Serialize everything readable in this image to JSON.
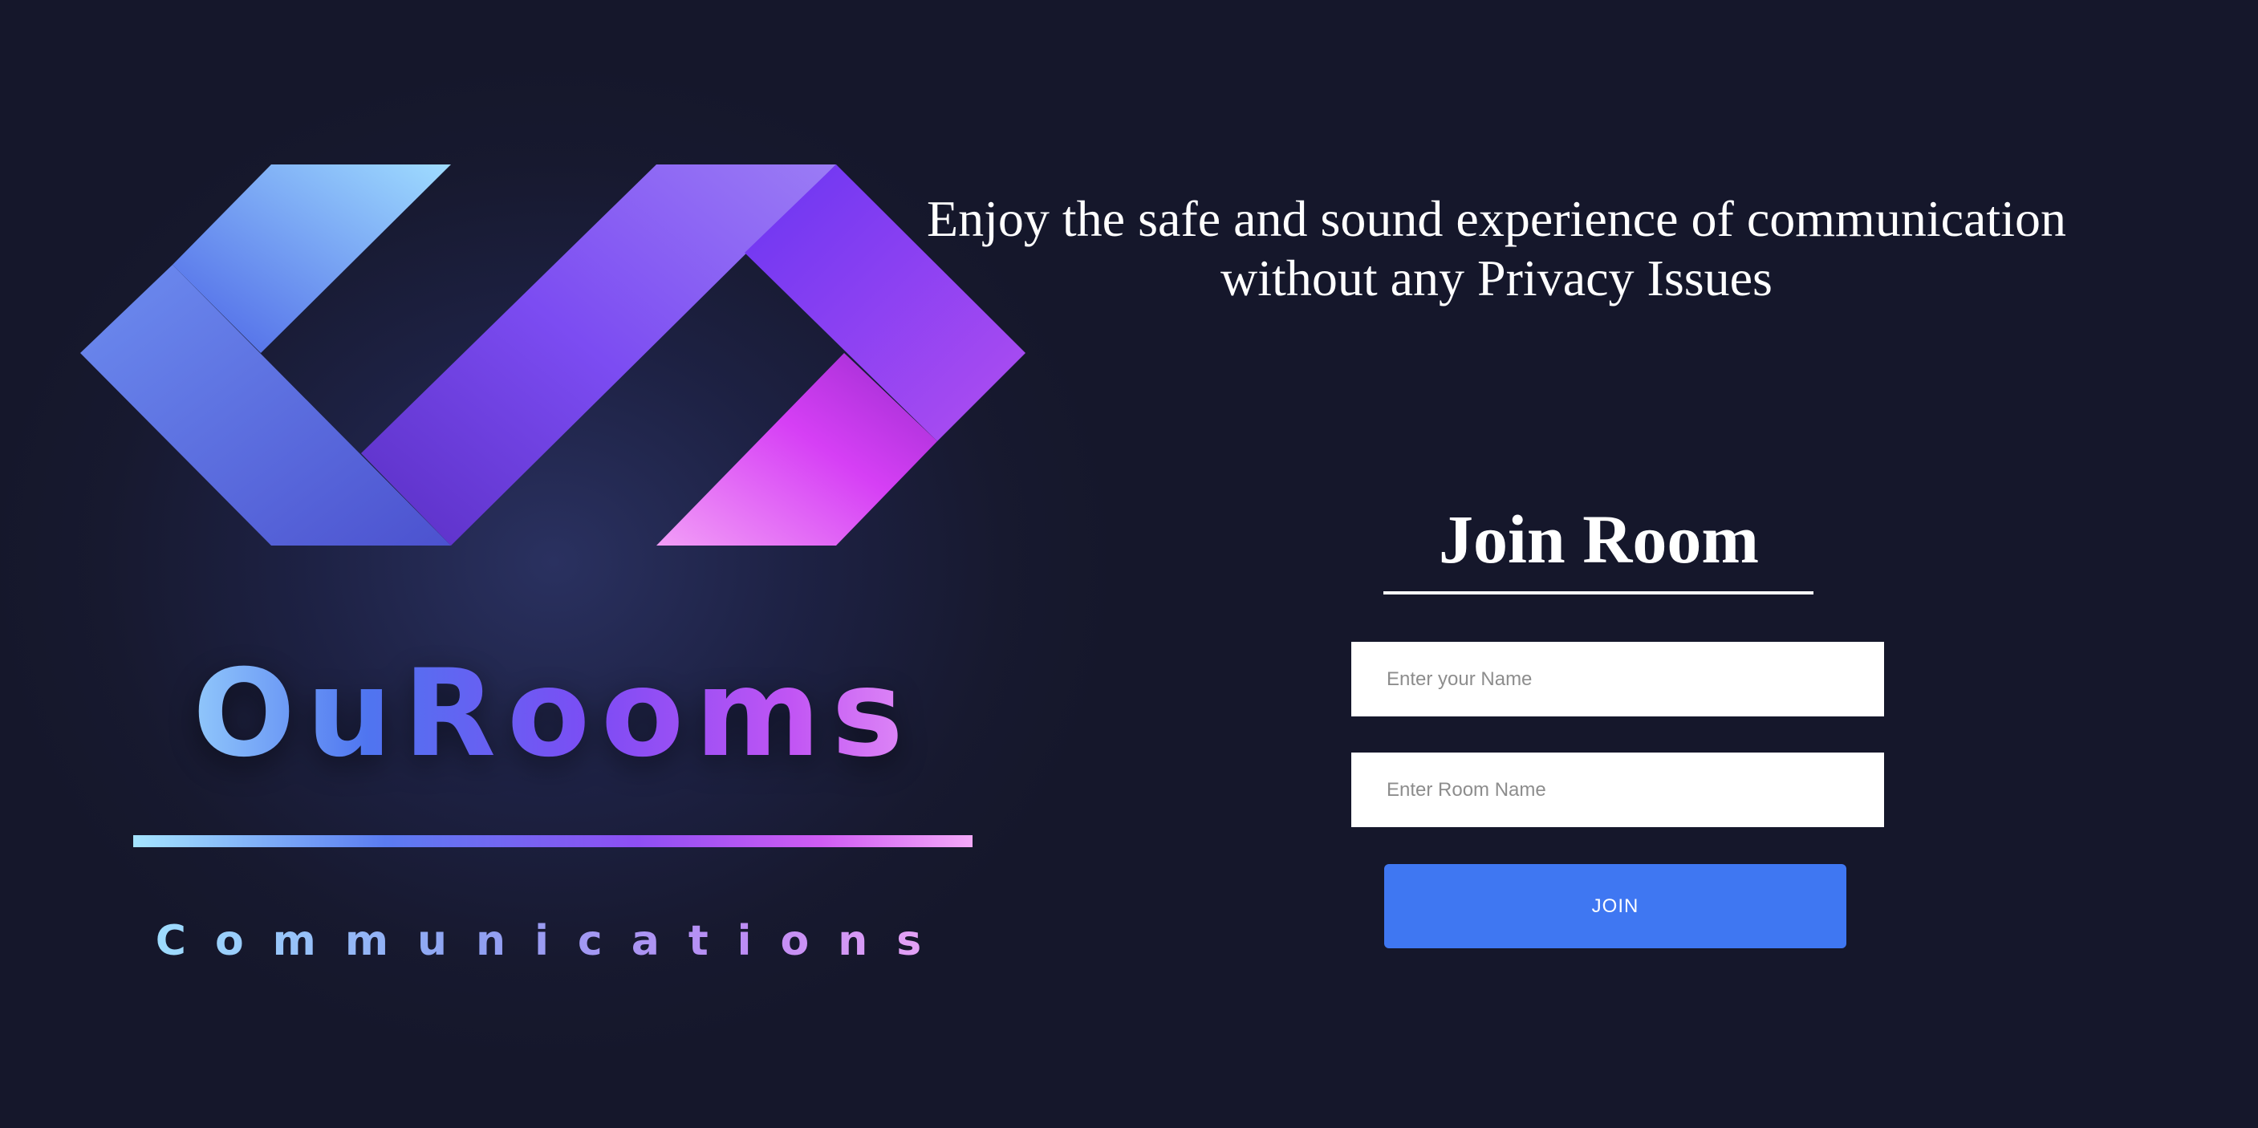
{
  "brand": {
    "name": "OuRooms",
    "subtitle": "Communications"
  },
  "tagline": {
    "line1": "Enjoy the safe and sound experience of communication",
    "line2": "without any Privacy Issues"
  },
  "join_form": {
    "title": "Join Room",
    "name_placeholder": "Enter your Name",
    "room_placeholder": "Enter Room Name",
    "button_label": "JOIN"
  },
  "colors": {
    "background": "#15172b",
    "accent_button": "#3f77f2",
    "gradient_start": "#a9e6ff",
    "gradient_mid": "#7d4cf4",
    "gradient_end": "#f0a6f7"
  },
  "icons": {
    "logo": "ourooms-infinity-ribbon-logo"
  }
}
